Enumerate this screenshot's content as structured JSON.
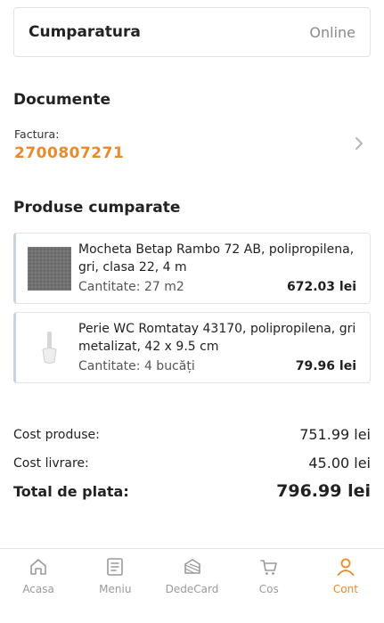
{
  "purchase": {
    "title": "Cumparatura",
    "channel": "Online"
  },
  "documents": {
    "title": "Documente",
    "invoice_label": "Factura:",
    "invoice_number": "2700807271"
  },
  "products_section": {
    "title": "Produse cumparate",
    "items": [
      {
        "name": "Mocheta Betap Rambo 72 AB, polipropilena, gri, clasa 22, 4 m",
        "quantity": "Cantitate: 27 m2",
        "price": "672.03 lei",
        "thumb_icon": "carpet-thumbnail"
      },
      {
        "name": "Perie WC Romtatay 43170, polipropilena, gri metalizat, 42 x 9.5 cm",
        "quantity": "Cantitate: 4 bucăți",
        "price": "79.96 lei",
        "thumb_icon": "toilet-brush-thumbnail"
      }
    ]
  },
  "costs": {
    "products_label": "Cost produse:",
    "products_value": "751.99 lei",
    "delivery_label": "Cost livrare:",
    "delivery_value": "45.00 lei",
    "total_label": "Total de plata:",
    "total_value": "796.99 lei"
  },
  "nav": {
    "items": [
      {
        "label": "Acasa",
        "icon": "home-icon",
        "active": false
      },
      {
        "label": "Meniu",
        "icon": "menu-icon",
        "active": false
      },
      {
        "label": "DedeCard",
        "icon": "card-icon",
        "active": false
      },
      {
        "label": "Cos",
        "icon": "cart-icon",
        "active": false
      },
      {
        "label": "Cont",
        "icon": "account-icon",
        "active": true
      }
    ]
  },
  "colors": {
    "accent": "#e88a2d",
    "text": "#1f1f1f",
    "muted": "#8a8a8a",
    "border": "#e3e3e3"
  }
}
